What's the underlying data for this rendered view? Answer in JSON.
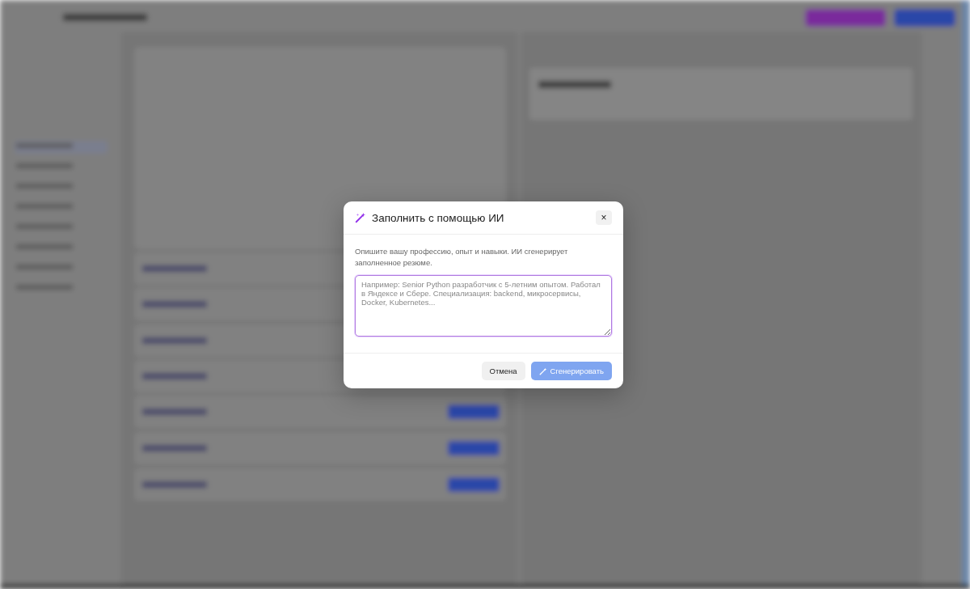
{
  "dialog": {
    "title": "Заполнить с помощью ИИ",
    "close": "×",
    "description": "Опишите вашу профессию, опыт и навыки. ИИ сгенерирует заполненное резюме.",
    "prompt": {
      "placeholder": "Например: Senior Python разработчик с 5-летним опытом. Работал в Яндексе и Сбере. Специализация: backend, микросервисы, Docker, Kubernetes...",
      "focused": true
    },
    "buttons": [
      {
        "label": "Отмена",
        "kind": "secondary",
        "disabled": false
      },
      {
        "label": "Сгенерировать",
        "kind": "primary",
        "disabled": true
      }
    ]
  }
}
